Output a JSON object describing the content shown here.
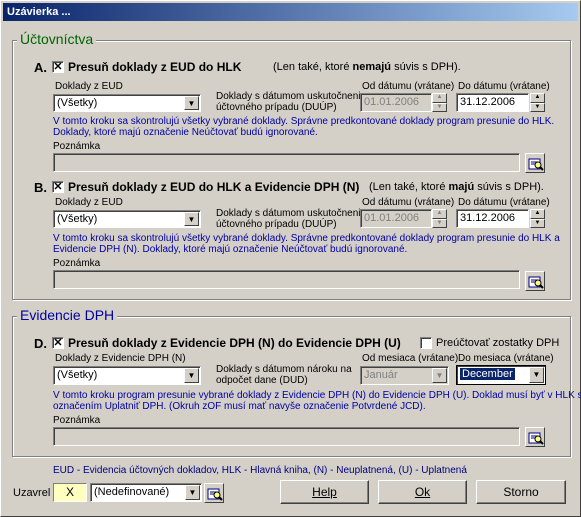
{
  "window": {
    "title": "Uzávierka ..."
  },
  "ucto": {
    "title": "Účtovníctva",
    "a": {
      "letter": "A.",
      "checked": true,
      "main": "Presuň doklady z EUD do HLK",
      "note_pre": "(Len také, ktoré ",
      "note_bold": "nemajú",
      "note_post": " súvis s DPH).",
      "doklady_label": "Doklady z EUD",
      "doklady_value": "(Všetky)",
      "datum_label_1": "Doklady s dátumom uskutočnenia",
      "datum_label_2": "účtovného prípadu (DUÚP)",
      "od_label": "Od dátumu (vrátane)",
      "od_value": "01.01.2006",
      "do_label": "Do dátumu (vrátane)",
      "do_value": "31.12.2006",
      "info_1": "V tomto kroku sa skontrolujú všetky vybrané doklady. Správne predkontované doklady program presunie do HLK.",
      "info_2": "Doklady, ktoré majú označenie Neúčtovať budú ignorované.",
      "poznamka_label": "Poznámka",
      "poznamka_value": ""
    },
    "b": {
      "letter": "B.",
      "checked": true,
      "main": "Presuň doklady z EUD do HLK a Evidencie DPH (N)",
      "note_pre": "(Len také, ktoré ",
      "note_bold": "majú",
      "note_post": " súvis s DPH).",
      "doklady_label": "Doklady z EUD",
      "doklady_value": "(Všetky)",
      "datum_label_1": "Doklady s dátumom uskutočnenia",
      "datum_label_2": "účtovného prípadu (DUÚP)",
      "od_label": "Od dátumu (vrátane)",
      "od_value": "01.01.2006",
      "do_label": "Do dátumu (vrátane)",
      "do_value": "31.12.2006",
      "info_1": "V tomto kroku sa skontrolujú všetky vybrané doklady. Správne predkontované doklady program presunie do HLK a",
      "info_2": "Evidencie DPH (N). Doklady, ktoré majú označenie Neúčtovať budú ignorované.",
      "poznamka_label": "Poznámka",
      "poznamka_value": ""
    }
  },
  "dph": {
    "title": "Evidencie DPH",
    "d": {
      "letter": "D.",
      "checked": true,
      "main": "Presuň doklady z Evidencie DPH (N) do Evidencie DPH (U)",
      "preuct_label": "Preúčtovať zostatky DPH",
      "preuct_checked": false,
      "doklady_label": "Doklady z Evidencie DPH (N)",
      "doklady_value": "(Všetky)",
      "datum_label_1": "Doklady s dátumom nároku na",
      "datum_label_2": "odpočet dane (DUD)",
      "od_label": "Od mesiaca (vrátane)",
      "od_value": "Január",
      "do_label": "Do mesiaca (vrátane)",
      "do_value": "December",
      "info_1": "V tomto kroku program presunie vybrané doklady z Evidencie DPH (N) do Evidencie DPH (U). Doklad musí byť v HLK s",
      "info_2": "označením Uplatniť DPH. (Okruh zOF musí mať navyše označenie Potvrdené JCD).",
      "poznamka_label": "Poznámka",
      "poznamka_value": ""
    }
  },
  "legend": "EUD - Evidencia účtovných dokladov, HLK - Hlavná kniha, (N) - Neuplatnená, (U) - Uplatnená",
  "footer": {
    "uzavrel_label": "Uzavrel",
    "uzavrel_value": "X",
    "user_value": "(Nedefinované)",
    "help": "Help",
    "ok": "Ok",
    "storno": "Storno"
  },
  "icons": {
    "check": "check-x-icon",
    "dropdown": "chevron-down-icon",
    "lookup": "lookup-icon"
  }
}
